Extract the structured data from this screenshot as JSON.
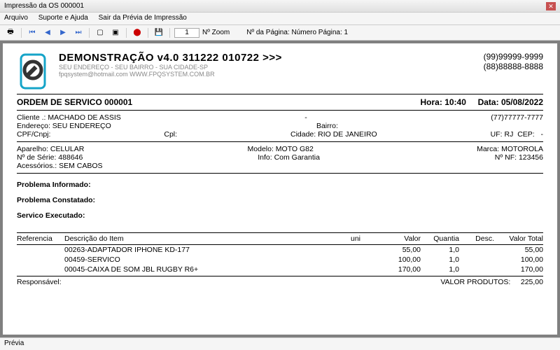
{
  "window": {
    "title": "Impressão da OS 000001"
  },
  "menu": {
    "arquivo": "Arquivo",
    "suporte": "Suporte e Ajuda",
    "sair": "Sair da Prévia de Impressão"
  },
  "toolbar": {
    "zoom_value": "1",
    "zoom_label": "Nº Zoom",
    "page_label": "Nº da Página: Número Página: 1"
  },
  "company": {
    "name": "DEMONSTRAÇÃO v4.0 311222 010722 >>>",
    "address": "SEU ENDEREÇO - SEU BAIRRO - SUA CIDADE-SP",
    "contact": "fpqsystem@hotmail.com  WWW.FPQSYSTEM.COM.BR",
    "phone1": "(99)99999-9999",
    "phone2": "(88)88888-8888"
  },
  "order": {
    "title": "ORDEM DE SERVICO 000001",
    "hora_lbl": "Hora:",
    "hora": "10:40",
    "data_lbl": "Data:",
    "data": "05/08/2022"
  },
  "cliente": {
    "lbl": "Cliente   .:",
    "nome": "MACHADO DE ASSIS",
    "dash": "-",
    "fone": "(77)77777-7777",
    "end_lbl": "Endereço:",
    "end": "SEU ENDEREÇO",
    "bairro_lbl": "Bairro:",
    "cpf_lbl": "CPF/Cnpj:",
    "cpl_lbl": "Cpl:",
    "cid_lbl": "Cidade:",
    "cid": "RIO DE JANEIRO",
    "uf_lbl": "UF:",
    "uf": "RJ",
    "cep_lbl": "CEP:",
    "cep": "-"
  },
  "aparelho": {
    "lbl": "Aparelho:",
    "val": "CELULAR",
    "modelo_lbl": "Modelo:",
    "modelo": "MOTO G82",
    "marca_lbl": "Marca:",
    "marca": "MOTOROLA",
    "serie_lbl": "Nº de Série:",
    "serie": "488646",
    "info_lbl": "Info:",
    "info": "Com Garantia",
    "nf_lbl": "Nº NF:",
    "nf": "123456",
    "acess_lbl": "Acessórios.:",
    "acess": "SEM CABOS"
  },
  "sections": {
    "informado": "Problema Informado:",
    "constatado": "Problema Constatado:",
    "executado": "Servico Executado:"
  },
  "table": {
    "h_ref": "Referencia",
    "h_desc": "Descrição do Item",
    "h_uni": "uni",
    "h_val": "Valor",
    "h_qty": "Quantia",
    "h_dsc": "Desc.",
    "h_tot": "Valor Total",
    "rows": [
      {
        "ref": "",
        "desc": "00263-ADAPTADOR IPHONE KD-177",
        "val": "55,00",
        "qty": "1,0",
        "tot": "55,00"
      },
      {
        "ref": "",
        "desc": "00459-SERVICO",
        "val": "100,00",
        "qty": "1,0",
        "tot": "100,00"
      },
      {
        "ref": "",
        "desc": "00045-CAIXA DE SOM JBL RUGBY R6+",
        "val": "170,00",
        "qty": "1,0",
        "tot": "170,00"
      }
    ]
  },
  "footer": {
    "resp": "Responsável:",
    "total_lbl": "VALOR PRODUTOS:",
    "total_val": "225,00"
  },
  "status": {
    "text": "Prévia"
  }
}
